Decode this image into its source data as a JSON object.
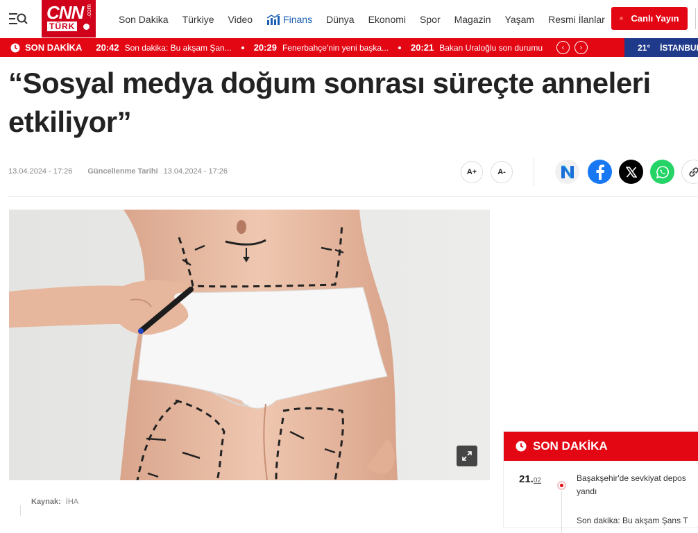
{
  "header": {
    "logo_cnn": "CNN",
    "logo_turk": "TÜRK",
    "logo_com": ".com",
    "nav": [
      "Son Dakika",
      "Türkiye",
      "Video",
      "Finans",
      "Dünya",
      "Ekonomi",
      "Spor",
      "Magazin",
      "Yaşam",
      "Resmi İlanlar"
    ],
    "live_label": "Canlı Yayın"
  },
  "breaking": {
    "label": "SON DAKİKA",
    "items": [
      {
        "time": "20:42",
        "text": "Son dakika: Bu akşam Şan..."
      },
      {
        "time": "20:29",
        "text": "Fenerbahçe'nin yeni başka..."
      },
      {
        "time": "20:21",
        "text": "Bakan Uraloğlu son durumu"
      }
    ]
  },
  "weather": {
    "temp": "21°",
    "city": "İSTANBUL"
  },
  "article": {
    "title_line1": "“Sosyal medya doğum sonrası süreçte anneleri",
    "title_line2": "etkiliyor”",
    "published": "13.04.2024 - 17:26",
    "updated_label": "Güncellenme Tarihi",
    "updated": "13.04.2024 - 17:26",
    "font_up": "A+",
    "font_down": "A-",
    "source_label": "Kaynak:",
    "source_value": "İHA"
  },
  "share": {
    "icons": [
      "newsletter-icon",
      "facebook-icon",
      "x-icon",
      "whatsapp-icon",
      "link-icon"
    ],
    "colors": {
      "facebook": "#1877f2",
      "x": "#000000",
      "whatsapp": "#25d366"
    }
  },
  "son_dakika_panel": {
    "title": "SON DAKİKA",
    "day": "21.",
    "month": "02",
    "item1": "Başakşehir'de sevkiyat depos",
    "item1_line2": "yandı",
    "item2": "Son dakika: Bu akşam Şans T"
  },
  "colors": {
    "brand_red": "#e30613",
    "weather_blue": "#1f3a8a"
  }
}
